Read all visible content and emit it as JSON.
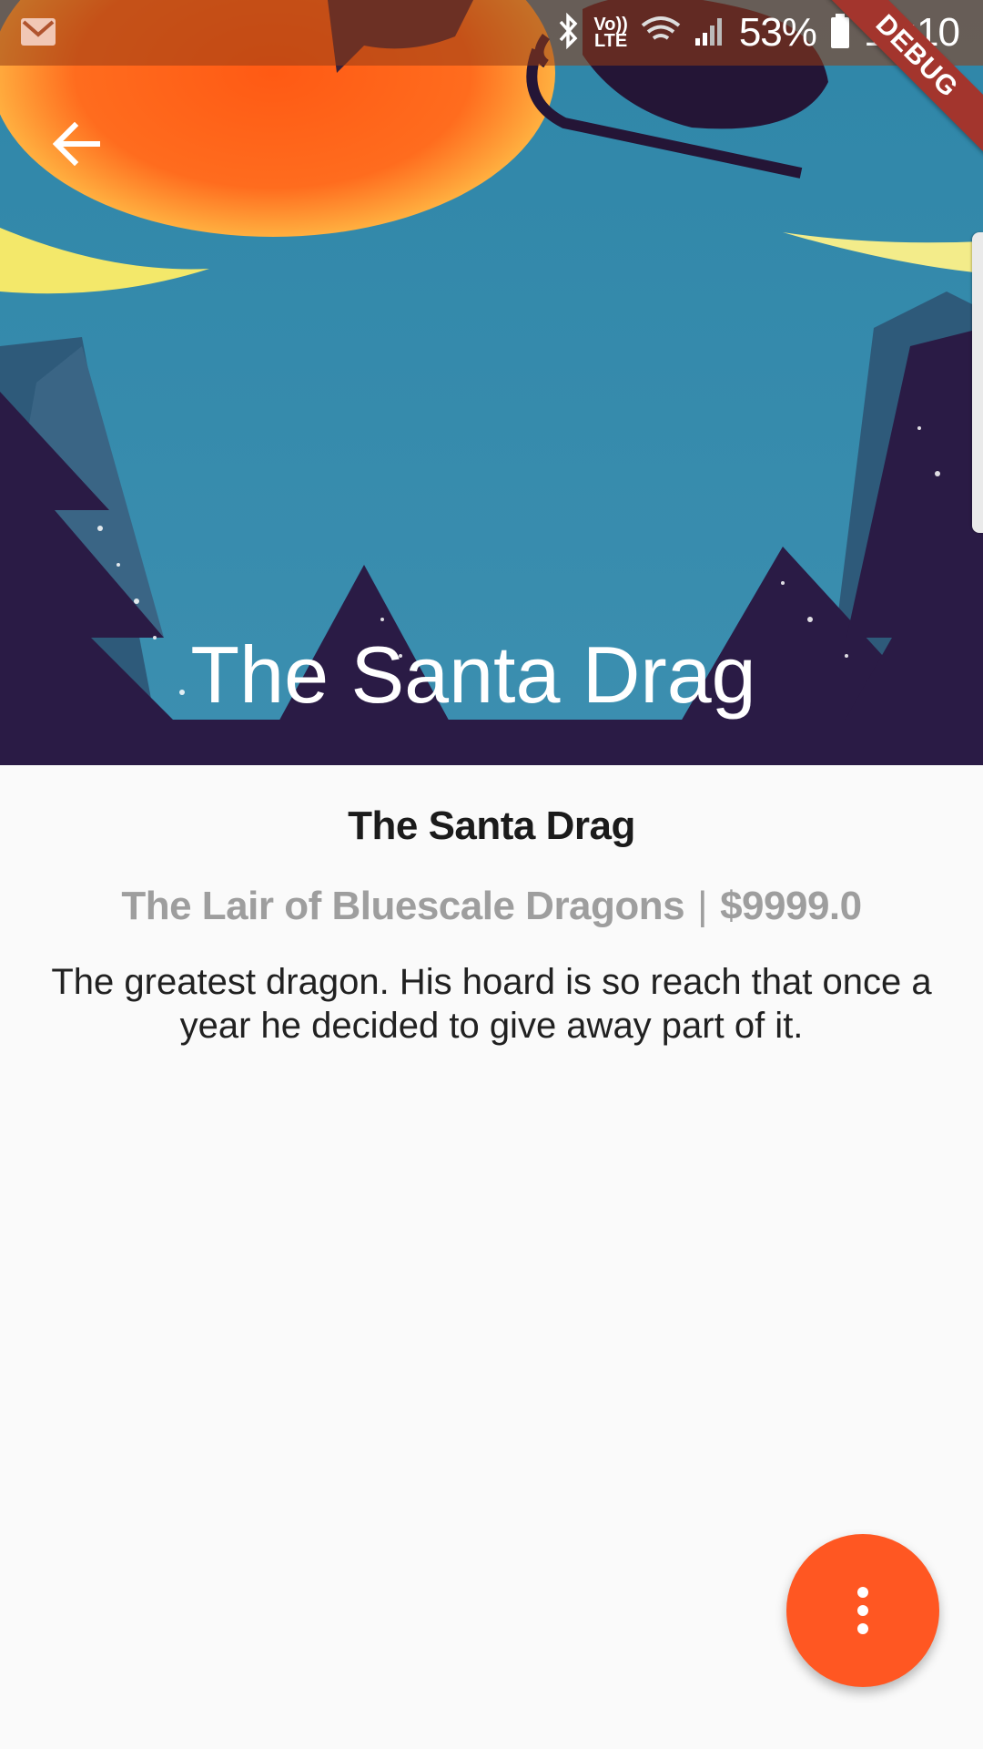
{
  "status_bar": {
    "battery_percent": "53%",
    "time": "16:10",
    "lte_label_top": "Vo))",
    "lte_label_bottom": "LTE",
    "icons": [
      "gmail-icon",
      "bluetooth-icon",
      "volte-icon",
      "wifi-icon",
      "signal-icon",
      "battery-icon"
    ]
  },
  "debug_banner": "DEBUG",
  "app_bar": {
    "back_icon": "arrow-back-icon",
    "title": "The Santa Drag"
  },
  "dragon": {
    "name": "The Santa Drag",
    "location": "The Lair of Bluescale Dragons",
    "separator": "|",
    "price": "$9999.0",
    "description": "The greatest dragon. His hoard is so reach that once a year he decided to give away part of it."
  },
  "fab": {
    "icon": "more-vert-icon"
  },
  "colors": {
    "accent": "#ff5722",
    "sky": "#3a8fae",
    "moon": "#ff6a1a",
    "trees": "#2a1b45",
    "meta_text": "#9e9e9e"
  }
}
